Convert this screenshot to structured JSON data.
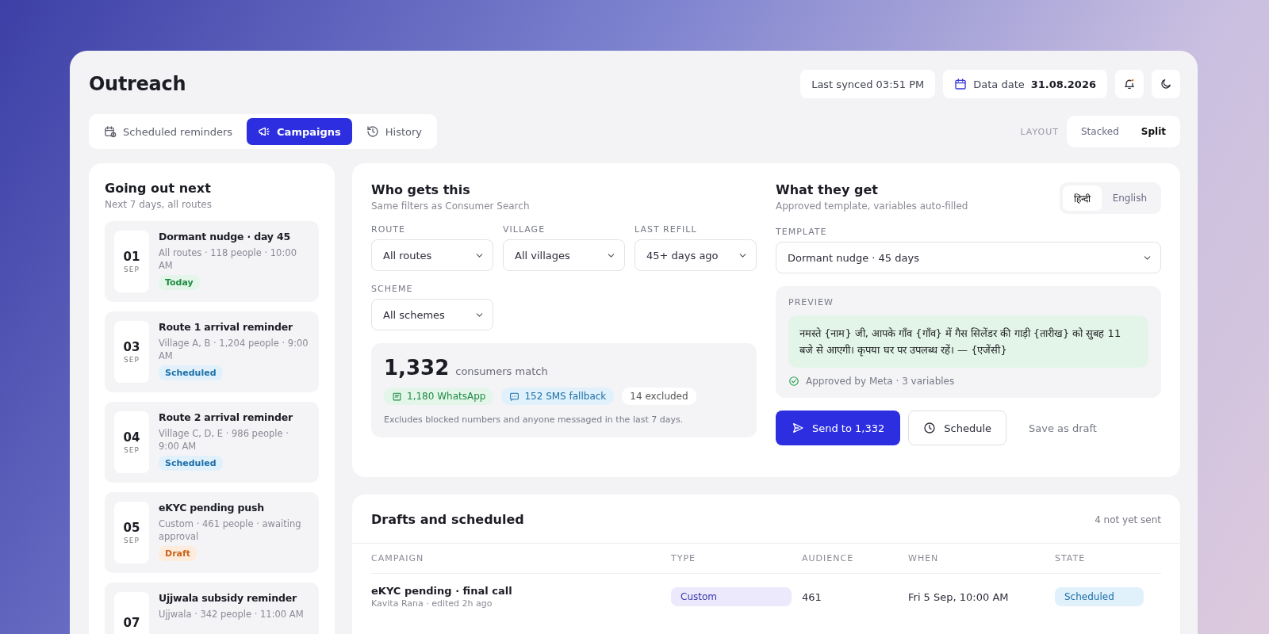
{
  "header": {
    "title": "Outreach",
    "last_synced": "Last synced 03:51 PM",
    "data_date_label": "Data date",
    "data_date_value": "31.08.2026",
    "notification_dot": true
  },
  "tabs": [
    {
      "label": "Scheduled reminders",
      "kind": "calendar",
      "selected": false
    },
    {
      "label": "Campaigns",
      "kind": "megaphone",
      "selected": true
    },
    {
      "label": "History",
      "kind": "history",
      "selected": false
    }
  ],
  "layout": {
    "label": "LAYOUT",
    "options": [
      {
        "label": "Stacked",
        "selected": false
      },
      {
        "label": "Split",
        "selected": true
      }
    ]
  },
  "upcoming": {
    "title": "Going out next",
    "subtitle": "Next 7 days, all routes",
    "items": [
      {
        "day": "01",
        "month": "SEP",
        "title": "Dormant nudge · day 45",
        "meta": "All routes · 118 people · 10:00 AM",
        "status": {
          "label": "Today",
          "kind": "today"
        }
      },
      {
        "day": "03",
        "month": "SEP",
        "title": "Route 1 arrival reminder",
        "meta": "Village A, B · 1,204 people · 9:00 AM",
        "status": {
          "label": "Scheduled",
          "kind": "scheduled"
        }
      },
      {
        "day": "04",
        "month": "SEP",
        "title": "Route 2 arrival reminder",
        "meta": "Village C, D, E · 986 people · 9:00 AM",
        "status": {
          "label": "Scheduled",
          "kind": "scheduled"
        }
      },
      {
        "day": "05",
        "month": "SEP",
        "title": "eKYC pending push",
        "meta": "Custom · 461 people · awaiting approval",
        "status": {
          "label": "Draft",
          "kind": "draft"
        }
      },
      {
        "day": "07",
        "title": "Ujjwala subsidy reminder",
        "meta": "Ujjwala · 342 people · 11:00 AM"
      }
    ]
  },
  "audience": {
    "title": "Who gets this",
    "subtitle": "Same filters as Consumer Search",
    "filters": [
      {
        "label": "ROUTE",
        "value": "All routes"
      },
      {
        "label": "VILLAGE",
        "value": "All villages"
      },
      {
        "label": "LAST REFILL",
        "value": "45+ days ago"
      },
      {
        "label": "SCHEME",
        "value": "All schemes"
      }
    ],
    "match": {
      "count": "1,332",
      "label": "consumers match",
      "channels": [
        {
          "kind": "whatsapp",
          "label": "1,180 WhatsApp"
        },
        {
          "kind": "sms",
          "label": "152 SMS fallback"
        },
        {
          "kind": "excluded",
          "label": "14 excluded"
        }
      ],
      "note": "Excludes blocked numbers and anyone messaged in the last 7 days."
    }
  },
  "message": {
    "title": "What they get",
    "subtitle": "Approved template, variables auto-filled",
    "languages": [
      {
        "label": "हिन्दी",
        "selected": true
      },
      {
        "label": "English",
        "selected": false
      }
    ],
    "template": {
      "label": "TEMPLATE",
      "value": "Dormant nudge · 45 days"
    },
    "preview": {
      "label": "PREVIEW",
      "text": "नमस्ते {नाम} जी, आपके गाँव {गाँव} में गैस सिलेंडर की गाड़ी {तारीख} को सुबह 11 बजे से आएगी। कृपया घर पर उपलब्ध रहें। — {एजेंसी}",
      "approval": "Approved by Meta · 3 variables"
    },
    "actions": [
      {
        "kind": "primary",
        "label": "Send to 1,332"
      },
      {
        "kind": "secondary",
        "label": "Schedule"
      },
      {
        "kind": "link",
        "label": "Save as draft"
      }
    ]
  },
  "drafts": {
    "title": "Drafts and scheduled",
    "count_note": "4 not yet sent",
    "columns": [
      "CAMPAIGN",
      "TYPE",
      "AUDIENCE",
      "WHEN",
      "STATE"
    ],
    "rows": [
      {
        "campaign": "eKYC pending · final call",
        "byline": "Kavita Rana · edited 2h ago",
        "type": {
          "label": "Custom",
          "kind": "custom"
        },
        "audience": "461",
        "when": "Fri 5 Sep, 10:00 AM",
        "state": {
          "label": "Scheduled",
          "kind": "scheduled"
        }
      }
    ]
  }
}
